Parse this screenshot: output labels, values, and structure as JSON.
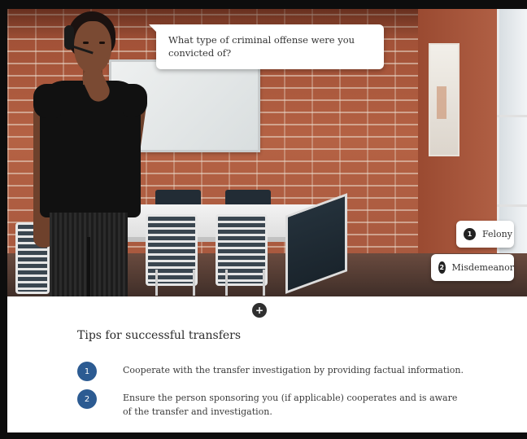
{
  "scene": {
    "prompt_text": "What type of criminal offense were you convicted of?"
  },
  "choices": [
    {
      "number": "1",
      "label": "Felony"
    },
    {
      "number": "2",
      "label": "Misdemeanor"
    }
  ],
  "expand_button": {
    "label": "+"
  },
  "tips": {
    "title": "Tips for successful transfers",
    "items": [
      {
        "number": "1",
        "text": "Cooperate with the transfer investigation by providing factual information."
      },
      {
        "number": "2",
        "text": "Ensure the person sponsoring you (if applicable) cooperates and is aware of the transfer and investigation."
      }
    ]
  },
  "colors": {
    "accent_blue": "#2c5b92",
    "brick": "#a9553a",
    "dark_badge": "#222222"
  }
}
